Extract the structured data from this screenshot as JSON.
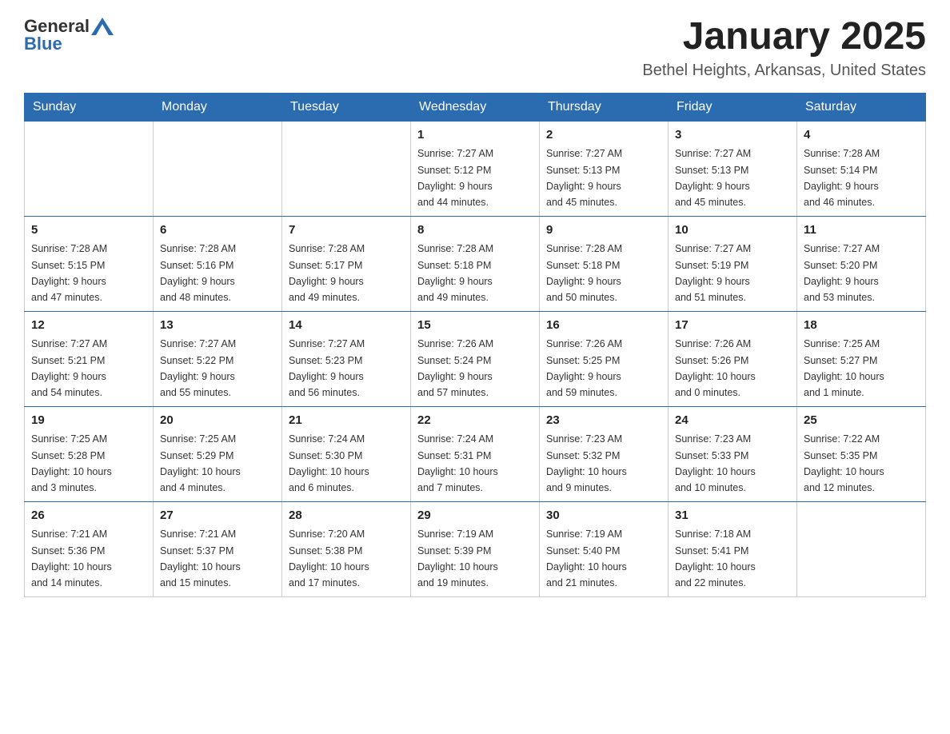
{
  "header": {
    "logo_text_general": "General",
    "logo_text_blue": "Blue",
    "month_title": "January 2025",
    "location": "Bethel Heights, Arkansas, United States"
  },
  "days_of_week": [
    "Sunday",
    "Monday",
    "Tuesday",
    "Wednesday",
    "Thursday",
    "Friday",
    "Saturday"
  ],
  "weeks": [
    [
      {
        "day": "",
        "info": ""
      },
      {
        "day": "",
        "info": ""
      },
      {
        "day": "",
        "info": ""
      },
      {
        "day": "1",
        "info": "Sunrise: 7:27 AM\nSunset: 5:12 PM\nDaylight: 9 hours\nand 44 minutes."
      },
      {
        "day": "2",
        "info": "Sunrise: 7:27 AM\nSunset: 5:13 PM\nDaylight: 9 hours\nand 45 minutes."
      },
      {
        "day": "3",
        "info": "Sunrise: 7:27 AM\nSunset: 5:13 PM\nDaylight: 9 hours\nand 45 minutes."
      },
      {
        "day": "4",
        "info": "Sunrise: 7:28 AM\nSunset: 5:14 PM\nDaylight: 9 hours\nand 46 minutes."
      }
    ],
    [
      {
        "day": "5",
        "info": "Sunrise: 7:28 AM\nSunset: 5:15 PM\nDaylight: 9 hours\nand 47 minutes."
      },
      {
        "day": "6",
        "info": "Sunrise: 7:28 AM\nSunset: 5:16 PM\nDaylight: 9 hours\nand 48 minutes."
      },
      {
        "day": "7",
        "info": "Sunrise: 7:28 AM\nSunset: 5:17 PM\nDaylight: 9 hours\nand 49 minutes."
      },
      {
        "day": "8",
        "info": "Sunrise: 7:28 AM\nSunset: 5:18 PM\nDaylight: 9 hours\nand 49 minutes."
      },
      {
        "day": "9",
        "info": "Sunrise: 7:28 AM\nSunset: 5:18 PM\nDaylight: 9 hours\nand 50 minutes."
      },
      {
        "day": "10",
        "info": "Sunrise: 7:27 AM\nSunset: 5:19 PM\nDaylight: 9 hours\nand 51 minutes."
      },
      {
        "day": "11",
        "info": "Sunrise: 7:27 AM\nSunset: 5:20 PM\nDaylight: 9 hours\nand 53 minutes."
      }
    ],
    [
      {
        "day": "12",
        "info": "Sunrise: 7:27 AM\nSunset: 5:21 PM\nDaylight: 9 hours\nand 54 minutes."
      },
      {
        "day": "13",
        "info": "Sunrise: 7:27 AM\nSunset: 5:22 PM\nDaylight: 9 hours\nand 55 minutes."
      },
      {
        "day": "14",
        "info": "Sunrise: 7:27 AM\nSunset: 5:23 PM\nDaylight: 9 hours\nand 56 minutes."
      },
      {
        "day": "15",
        "info": "Sunrise: 7:26 AM\nSunset: 5:24 PM\nDaylight: 9 hours\nand 57 minutes."
      },
      {
        "day": "16",
        "info": "Sunrise: 7:26 AM\nSunset: 5:25 PM\nDaylight: 9 hours\nand 59 minutes."
      },
      {
        "day": "17",
        "info": "Sunrise: 7:26 AM\nSunset: 5:26 PM\nDaylight: 10 hours\nand 0 minutes."
      },
      {
        "day": "18",
        "info": "Sunrise: 7:25 AM\nSunset: 5:27 PM\nDaylight: 10 hours\nand 1 minute."
      }
    ],
    [
      {
        "day": "19",
        "info": "Sunrise: 7:25 AM\nSunset: 5:28 PM\nDaylight: 10 hours\nand 3 minutes."
      },
      {
        "day": "20",
        "info": "Sunrise: 7:25 AM\nSunset: 5:29 PM\nDaylight: 10 hours\nand 4 minutes."
      },
      {
        "day": "21",
        "info": "Sunrise: 7:24 AM\nSunset: 5:30 PM\nDaylight: 10 hours\nand 6 minutes."
      },
      {
        "day": "22",
        "info": "Sunrise: 7:24 AM\nSunset: 5:31 PM\nDaylight: 10 hours\nand 7 minutes."
      },
      {
        "day": "23",
        "info": "Sunrise: 7:23 AM\nSunset: 5:32 PM\nDaylight: 10 hours\nand 9 minutes."
      },
      {
        "day": "24",
        "info": "Sunrise: 7:23 AM\nSunset: 5:33 PM\nDaylight: 10 hours\nand 10 minutes."
      },
      {
        "day": "25",
        "info": "Sunrise: 7:22 AM\nSunset: 5:35 PM\nDaylight: 10 hours\nand 12 minutes."
      }
    ],
    [
      {
        "day": "26",
        "info": "Sunrise: 7:21 AM\nSunset: 5:36 PM\nDaylight: 10 hours\nand 14 minutes."
      },
      {
        "day": "27",
        "info": "Sunrise: 7:21 AM\nSunset: 5:37 PM\nDaylight: 10 hours\nand 15 minutes."
      },
      {
        "day": "28",
        "info": "Sunrise: 7:20 AM\nSunset: 5:38 PM\nDaylight: 10 hours\nand 17 minutes."
      },
      {
        "day": "29",
        "info": "Sunrise: 7:19 AM\nSunset: 5:39 PM\nDaylight: 10 hours\nand 19 minutes."
      },
      {
        "day": "30",
        "info": "Sunrise: 7:19 AM\nSunset: 5:40 PM\nDaylight: 10 hours\nand 21 minutes."
      },
      {
        "day": "31",
        "info": "Sunrise: 7:18 AM\nSunset: 5:41 PM\nDaylight: 10 hours\nand 22 minutes."
      },
      {
        "day": "",
        "info": ""
      }
    ]
  ]
}
